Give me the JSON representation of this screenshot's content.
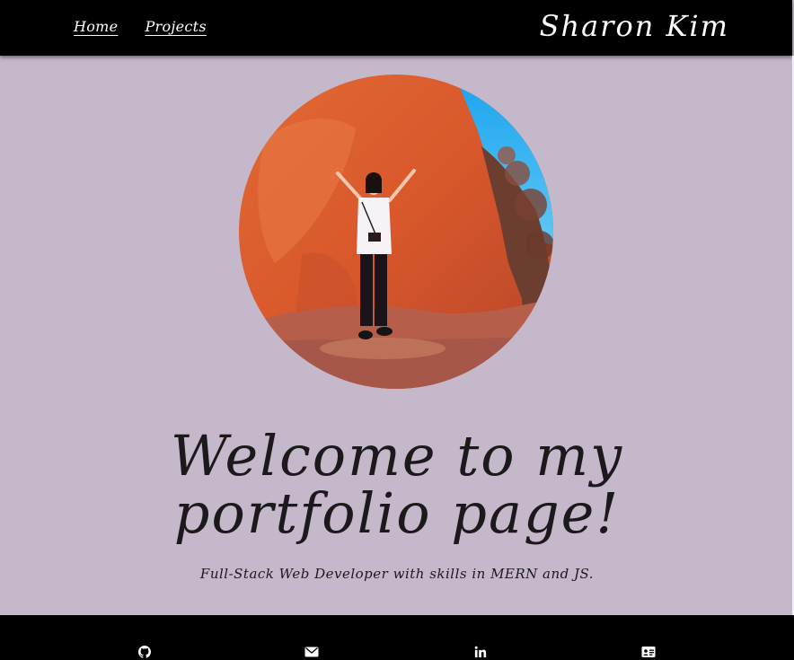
{
  "nav": {
    "links": [
      {
        "label": "Home"
      },
      {
        "label": "Projects"
      }
    ],
    "brand": "Sharon Kim"
  },
  "hero": {
    "headline_line1": "Welcome to my",
    "headline_line2": "portfolio page!",
    "subtitle": "Full-Stack Web Developer with skills in MERN and JS."
  },
  "footer": {
    "icons": [
      "github-icon",
      "envelope-icon",
      "linkedin-icon",
      "id-card-icon"
    ]
  },
  "colors": {
    "background": "#c6b8cb",
    "navbar": "#000000",
    "text_dark": "#1a1a1a",
    "text_light": "#ffffff"
  }
}
